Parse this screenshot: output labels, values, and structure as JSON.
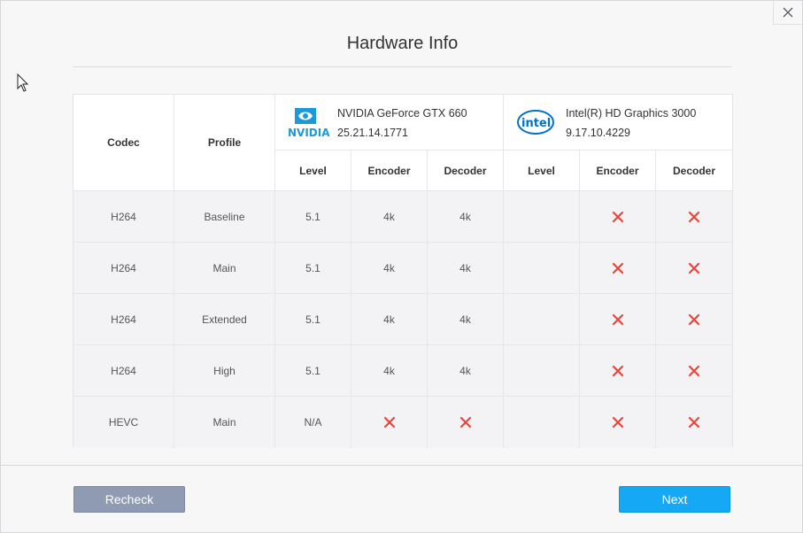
{
  "window": {
    "title": "Hardware Info"
  },
  "colors": {
    "accent": "#14a8f5",
    "secondary_button": "#8f9bb3",
    "unsupported": "#e8463c",
    "nvidia": "#1a9ad8",
    "intel": "#0071c5"
  },
  "table": {
    "headers": {
      "codec": "Codec",
      "profile": "Profile",
      "level": "Level",
      "encoder": "Encoder",
      "decoder": "Decoder"
    },
    "gpus": [
      {
        "logo": "NVIDIA",
        "name": "NVIDIA GeForce GTX 660",
        "version": "25.21.14.1771"
      },
      {
        "logo": "intel",
        "name": "Intel(R) HD Graphics 3000",
        "version": "9.17.10.4229"
      }
    ],
    "rows": [
      {
        "codec": "H264",
        "profile": "Baseline",
        "nv_level": "5.1",
        "nv_encoder": "4k",
        "nv_decoder": "4k",
        "in_level": "",
        "in_encoder": "x",
        "in_decoder": "x"
      },
      {
        "codec": "H264",
        "profile": "Main",
        "nv_level": "5.1",
        "nv_encoder": "4k",
        "nv_decoder": "4k",
        "in_level": "",
        "in_encoder": "x",
        "in_decoder": "x"
      },
      {
        "codec": "H264",
        "profile": "Extended",
        "nv_level": "5.1",
        "nv_encoder": "4k",
        "nv_decoder": "4k",
        "in_level": "",
        "in_encoder": "x",
        "in_decoder": "x"
      },
      {
        "codec": "H264",
        "profile": "High",
        "nv_level": "5.1",
        "nv_encoder": "4k",
        "nv_decoder": "4k",
        "in_level": "",
        "in_encoder": "x",
        "in_decoder": "x"
      },
      {
        "codec": "HEVC",
        "profile": "Main",
        "nv_level": "N/A",
        "nv_encoder": "x",
        "nv_decoder": "x",
        "in_level": "",
        "in_encoder": "x",
        "in_decoder": "x"
      }
    ]
  },
  "buttons": {
    "recheck": "Recheck",
    "next": "Next"
  }
}
